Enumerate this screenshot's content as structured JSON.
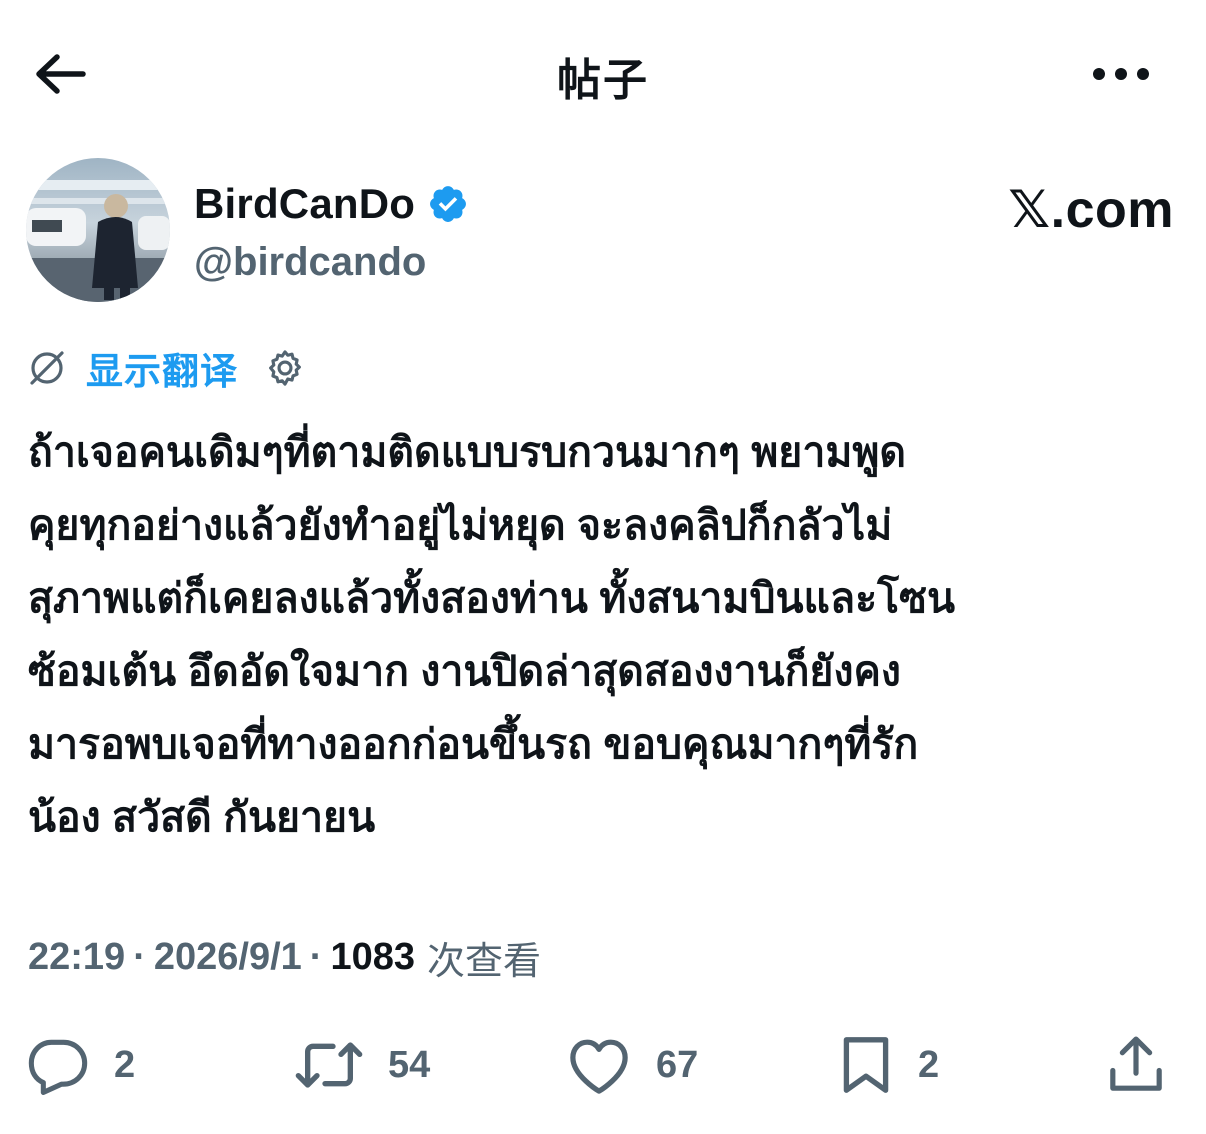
{
  "header": {
    "title": "帖子",
    "back_icon": "arrow-left-icon",
    "more_icon": "more-horizontal-icon"
  },
  "author": {
    "display_name": "BirdCanDo",
    "handle": "@birdcando",
    "verified_icon": "verified-badge-icon",
    "verified_color": "#1d9bf0"
  },
  "source": {
    "label": "𝕏.com"
  },
  "translate": {
    "label": "显示翻译",
    "icon": "translate-off-icon",
    "settings_icon": "gear-icon",
    "color": "#1d9bf0"
  },
  "tweet": {
    "text": "ถ้าเจอคนเดิมๆที่ตามติดแบบรบกวนมากๆ พยามพูด\nคุยทุกอย่างแล้วยังทำอยู่ไม่หยุด จะลงคลิปก็กลัวไม่\nสุภาพแต่ก็เคยลงแล้วทั้งสองท่าน ทั้งสนามบินและโซน\nซ้อมเต้น  อึดอัดใจมาก งานปิดล่าสุดสองงานก็ยังคง\nมารอพบเจอที่ทางออกก่อนขึ้นรถ   ขอบคุณมากๆที่รัก\nน้อง  สวัสดี กันยายน"
  },
  "meta": {
    "time": "22:19",
    "separator": "·",
    "date": "2026/9/1",
    "views_count": "1083",
    "views_label": "次查看"
  },
  "actions": {
    "reply_count": "2",
    "repost_count": "54",
    "like_count": "67",
    "bookmark_count": "2",
    "reply_icon": "reply-icon",
    "repost_icon": "repost-icon",
    "like_icon": "heart-icon",
    "bookmark_icon": "bookmark-icon",
    "share_icon": "share-icon"
  },
  "colors": {
    "text": "#0f1419",
    "secondary": "#536471",
    "accent": "#1d9bf0"
  }
}
